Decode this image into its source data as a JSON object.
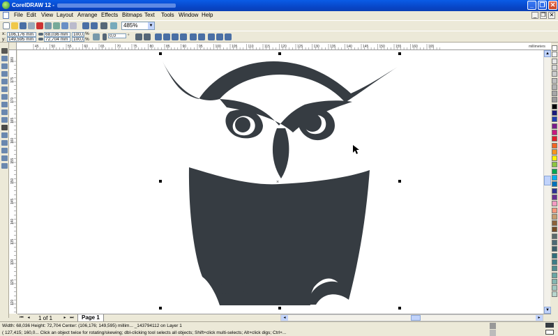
{
  "window": {
    "title": "CorelDRAW 12 - ",
    "min_label": "_",
    "max_label": "❐",
    "close_label": "✕"
  },
  "menu": {
    "items": [
      "File",
      "Edit",
      "View",
      "Layout",
      "Arrange",
      "Effects",
      "Bitmaps",
      "Text",
      "Tools",
      "Window",
      "Help"
    ],
    "mdi_min": "_",
    "mdi_restore": "❐",
    "mdi_close": "✕"
  },
  "toolbar": {
    "zoom": "485%"
  },
  "property_bar": {
    "x": "106,176 mm",
    "y": "149,595 mm",
    "width": "68,036 mm",
    "height": "72,704 mm",
    "scale_x": "100,0",
    "scale_y": "100,0",
    "percent_x": "%",
    "percent_y": "%",
    "angle": "0,0",
    "degree": "°"
  },
  "rulers": {
    "units": "millimeters",
    "h_ticks": [
      "45",
      "50",
      "55",
      "60",
      "65",
      "70",
      "75",
      "80",
      "85",
      "90",
      "95",
      "100",
      "105",
      "110",
      "115",
      "120",
      "125",
      "130",
      "135",
      "140",
      "145",
      "150",
      "155",
      "160",
      "165"
    ],
    "v_ticks": [
      "180",
      "175",
      "170",
      "165",
      "160",
      "155",
      "150",
      "145",
      "140",
      "135",
      "130",
      "125",
      "120"
    ]
  },
  "page_nav": {
    "info": "1 of 1",
    "page_tab": "Page 1",
    "first": "⏮",
    "prev": "◂",
    "next": "▸",
    "last": "⏭"
  },
  "status": {
    "line1": "Width: 68,036  Height: 72,704  Center: (106,176; 149,595)  millim...  _143794112 on Layer 1",
    "line2": "( 127,415; 160,0...    Click an object twice for rotating/skewing; dbl-clicking tool selects all objects; Shift+click multi-selects; Alt+click digs; Ctrl+..."
  },
  "colors": {
    "owl_fill": "#363c42",
    "palette": [
      "#ffffff",
      "#f2f2f2",
      "#e6e6e6",
      "#d9d9d9",
      "#cccccc",
      "#bfbfbf",
      "#b3b3b3",
      "#a6a6a6",
      "#999999",
      "#000000",
      "#1a1a7a",
      "#1f3fb0",
      "#7a1a8a",
      "#c8197e",
      "#e21d26",
      "#f26522",
      "#f7941d",
      "#fff200",
      "#8dc63f",
      "#00a651",
      "#00aeef",
      "#0072bc",
      "#2e3192",
      "#662d91",
      "#f49ac1",
      "#f7977a",
      "#c69c6d",
      "#8c6239",
      "#754c24",
      "#5a6b6a",
      "#4d6a73",
      "#3b5e69",
      "#2f6e7a",
      "#3d7d86",
      "#4f8d8f",
      "#6aa6a3",
      "#84b6b0",
      "#a2c8c0",
      "#b9d6cd"
    ]
  }
}
